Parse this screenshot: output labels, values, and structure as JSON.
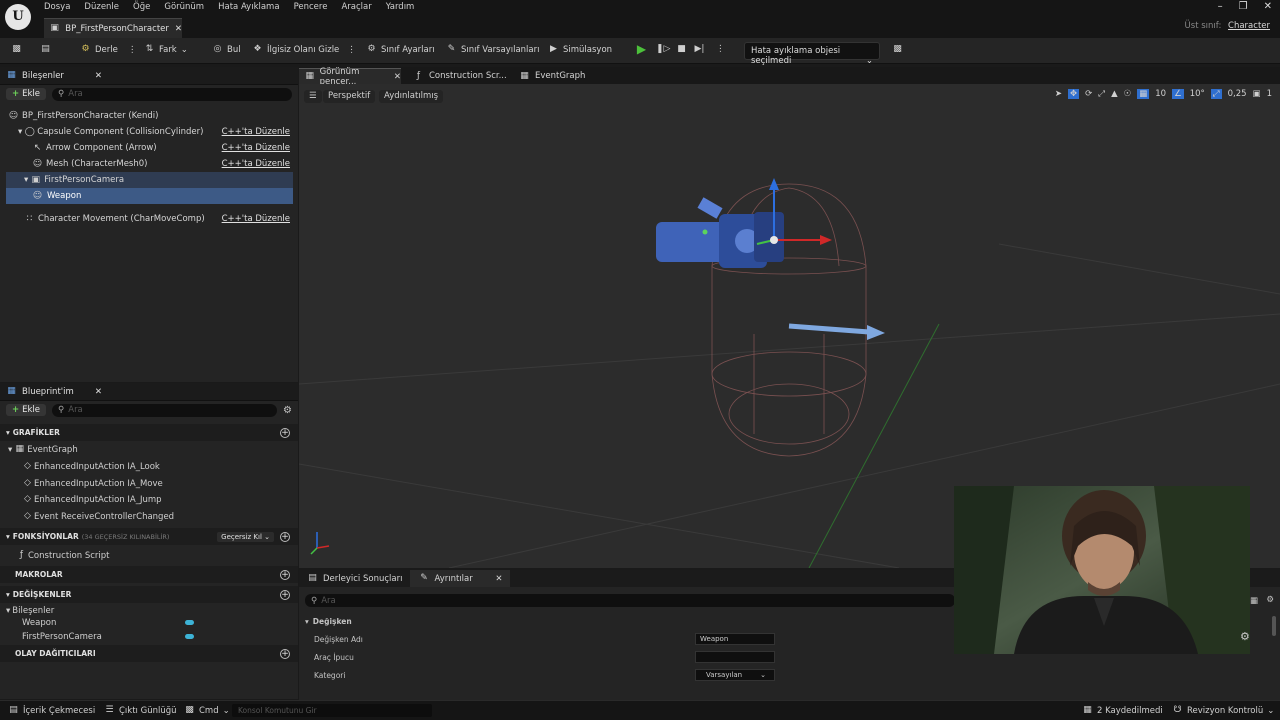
{
  "menu": [
    "Dosya",
    "Düzenle",
    "Öğe",
    "Görünüm",
    "Hata Ayıklama",
    "Pencere",
    "Araçlar",
    "Yardım"
  ],
  "logo": "U",
  "document_tab": "BP_FirstPersonCharacter",
  "parent_class": {
    "label": "Üst sınıf:",
    "value": "Character"
  },
  "toolbar": {
    "compile": "Derle",
    "diff": "Fark",
    "find": "Bul",
    "hide_unrelated": "İlgisiz Olanı Gizle",
    "class_settings": "Sınıf Ayarları",
    "class_defaults": "Sınıf Varsayılanları",
    "simulation": "Simülasyon",
    "debug_object": "Hata ayıklama objesi seçilmedi"
  },
  "components_panel": {
    "title": "Bileşenler",
    "add": "Ekle",
    "search_placeholder": "Ara",
    "edit_in_cpp": "C++'ta Düzenle",
    "items": [
      "BP_FirstPersonCharacter (Kendi)",
      "Capsule Component (CollisionCylinder)",
      "Arrow Component (Arrow)",
      "Mesh (CharacterMesh0)",
      "FirstPersonCamera",
      "Weapon",
      "Character Movement (CharMoveComp)"
    ]
  },
  "blueprint_panel": {
    "title": "Blueprint'im",
    "add": "Ekle",
    "search_placeholder": "Ara",
    "graphs_header": "GRAFİKLER",
    "event_graph": "EventGraph",
    "events": [
      "EnhancedInputAction IA_Look",
      "EnhancedInputAction IA_Move",
      "EnhancedInputAction IA_Jump",
      "Event ReceiveControllerChanged"
    ],
    "functions_header": "FONKSİYONLAR",
    "functions_note": "(34 GEÇERSİZ KILINABİLİR)",
    "override_label": "Geçersiz Kıl",
    "construction_script": "Construction Script",
    "macros_header": "MAKROLAR",
    "variables_header": "DEĞİŞKENLER",
    "components_group": "Bileşenler",
    "variables": [
      "Weapon",
      "FirstPersonCamera"
    ],
    "dispatchers_header": "OLAY DAĞITICILARI"
  },
  "viewport": {
    "tabs": [
      "Görünüm pencer...",
      "Construction Scr...",
      "EventGraph"
    ],
    "perspective": "Perspektif",
    "lit": "Aydınlatılmış",
    "grid_snap": "10",
    "rot_snap": "10°",
    "scale_snap": "0,25",
    "cam_speed": "1"
  },
  "bottom_panel": {
    "tabs": [
      "Derleyici Sonuçları",
      "Ayrıntılar"
    ],
    "search_placeholder": "Ara",
    "category": "Değişken",
    "rows": [
      {
        "label": "Değişken Adı",
        "value": "Weapon"
      },
      {
        "label": "Araç İpucu",
        "value": ""
      },
      {
        "label": "Kategori",
        "value": "Varsayılan"
      }
    ]
  },
  "statusbar": {
    "content_drawer": "İçerik Çekmecesi",
    "output_log": "Çıktı Günlüğü",
    "cmd": "Cmd",
    "console_placeholder": "Konsol Komutunu Gir",
    "unsaved": "2 Kaydedilmedi",
    "revision_control": "Revizyon Kontrolü"
  }
}
